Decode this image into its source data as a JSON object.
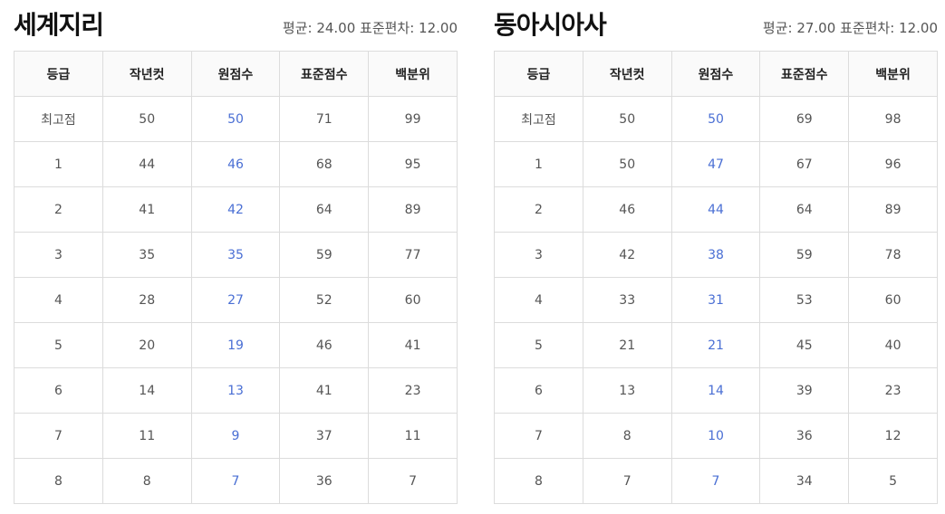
{
  "columns": [
    "등급",
    "작년컷",
    "원점수",
    "표준점수",
    "백분위"
  ],
  "colors": {
    "raw_score_accent": "#4a6fd4",
    "header_border": "#222222"
  },
  "panels": [
    {
      "title": "세계지리",
      "stats": "평균: 24.00 표준편차: 12.00",
      "rows": [
        [
          "최고점",
          "50",
          "50",
          "71",
          "99"
        ],
        [
          "1",
          "44",
          "46",
          "68",
          "95"
        ],
        [
          "2",
          "41",
          "42",
          "64",
          "89"
        ],
        [
          "3",
          "35",
          "35",
          "59",
          "77"
        ],
        [
          "4",
          "28",
          "27",
          "52",
          "60"
        ],
        [
          "5",
          "20",
          "19",
          "46",
          "41"
        ],
        [
          "6",
          "14",
          "13",
          "41",
          "23"
        ],
        [
          "7",
          "11",
          "9",
          "37",
          "11"
        ],
        [
          "8",
          "8",
          "7",
          "36",
          "7"
        ]
      ]
    },
    {
      "title": "동아시아사",
      "stats": "평균: 27.00 표준편차: 12.00",
      "rows": [
        [
          "최고점",
          "50",
          "50",
          "69",
          "98"
        ],
        [
          "1",
          "50",
          "47",
          "67",
          "96"
        ],
        [
          "2",
          "46",
          "44",
          "64",
          "89"
        ],
        [
          "3",
          "42",
          "38",
          "59",
          "78"
        ],
        [
          "4",
          "33",
          "31",
          "53",
          "60"
        ],
        [
          "5",
          "21",
          "21",
          "45",
          "40"
        ],
        [
          "6",
          "13",
          "14",
          "39",
          "23"
        ],
        [
          "7",
          "8",
          "10",
          "36",
          "12"
        ],
        [
          "8",
          "7",
          "7",
          "34",
          "5"
        ]
      ]
    }
  ]
}
